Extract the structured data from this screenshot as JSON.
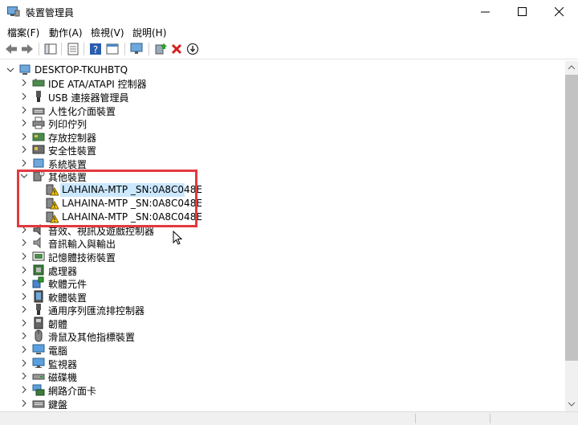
{
  "window": {
    "title": "裝置管理員"
  },
  "menu": [
    "檔案(F)",
    "動作(A)",
    "檢視(V)",
    "說明(H)"
  ],
  "toolbar": [
    "back-icon",
    "forward-icon",
    "console-tree-icon",
    "properties-icon",
    "help-icon",
    "view-icon",
    "monitor-icon",
    "update-driver-icon",
    "uninstall-icon",
    "disable-icon"
  ],
  "tree": {
    "root": "DESKTOP-TKUHBTQ",
    "items": [
      {
        "label": "IDE ATA/ATAPI 控制器",
        "icon": "ide-controller-icon"
      },
      {
        "label": "USB 連接器管理員",
        "icon": "usb-connector-icon"
      },
      {
        "label": "人性化介面裝置",
        "icon": "hid-icon"
      },
      {
        "label": "列印佇列",
        "icon": "printer-icon"
      },
      {
        "label": "存放控制器",
        "icon": "storage-controller-icon"
      },
      {
        "label": "安全性裝置",
        "icon": "security-device-icon"
      },
      {
        "label": "系統裝置",
        "icon": "system-device-icon"
      },
      {
        "label": "其他裝置",
        "icon": "other-device-icon",
        "expanded": true,
        "children": [
          {
            "label": "LAHAINA-MTP _SN:0A8C048E",
            "icon": "warning-device-icon",
            "selected": true
          },
          {
            "label": "LAHAINA-MTP _SN:0A8C048E",
            "icon": "warning-device-icon"
          },
          {
            "label": "LAHAINA-MTP _SN:0A8C048E",
            "icon": "warning-device-icon"
          }
        ]
      },
      {
        "label": "音效、視訊及遊戲控制器",
        "icon": "sound-icon"
      },
      {
        "label": "音訊輸入與輸出",
        "icon": "audio-io-icon"
      },
      {
        "label": "記憶體技術裝置",
        "icon": "memory-icon"
      },
      {
        "label": "處理器",
        "icon": "processor-icon"
      },
      {
        "label": "軟體元件",
        "icon": "software-component-icon"
      },
      {
        "label": "軟體裝置",
        "icon": "software-device-icon"
      },
      {
        "label": "通用序列匯流排控制器",
        "icon": "usb-controller-icon"
      },
      {
        "label": "韌體",
        "icon": "firmware-icon"
      },
      {
        "label": "滑鼠及其他指標裝置",
        "icon": "mouse-icon"
      },
      {
        "label": "電腦",
        "icon": "computer-icon"
      },
      {
        "label": "監視器",
        "icon": "monitor-icon"
      },
      {
        "label": "磁碟機",
        "icon": "disk-drive-icon"
      },
      {
        "label": "網路介面卡",
        "icon": "network-adapter-icon"
      },
      {
        "label": "鍵盤",
        "icon": "keyboard-icon"
      }
    ]
  },
  "colors": {
    "selection": "#cce8ff",
    "highlight_box": "#e2393f",
    "warning": "#f2c200"
  }
}
